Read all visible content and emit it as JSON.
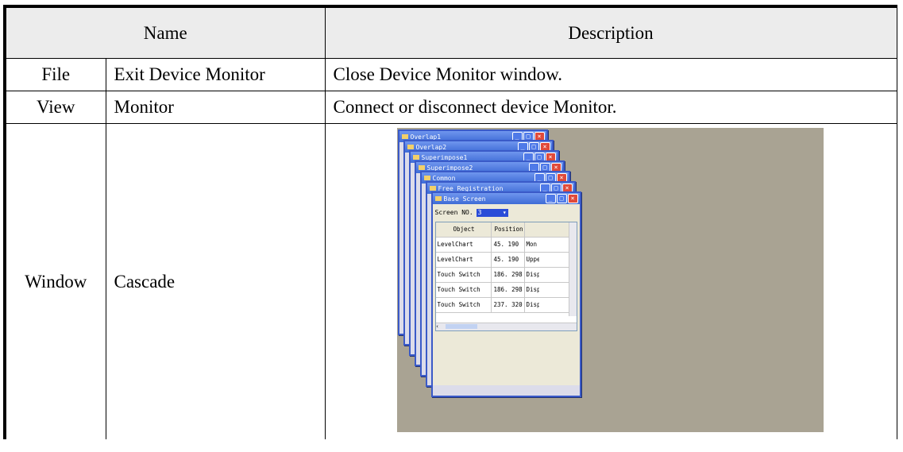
{
  "table": {
    "headers": {
      "name": "Name",
      "description": "Description"
    },
    "rows": [
      {
        "category": "File",
        "command": "Exit Device Monitor",
        "description": "Close Device Monitor window."
      },
      {
        "category": "View",
        "command": "Monitor",
        "description": "Connect or disconnect device Monitor."
      },
      {
        "category": "Window",
        "command": "Cascade",
        "description": ""
      }
    ]
  },
  "screenshot": {
    "background_color": "#a9a393",
    "windows": [
      "Overlap1",
      "Overlap2",
      "Superimpose1",
      "Superimpose2",
      "Common",
      "Free Registration",
      "Base Screen"
    ],
    "screen_no_label": "Screen NO.",
    "screen_no_value": "3",
    "columns": [
      "Object",
      "Position",
      ""
    ],
    "grid_rows": [
      [
        "LevelChart",
        "45. 190",
        "Mon"
      ],
      [
        "LevelChart",
        "45. 190",
        "Uppe"
      ],
      [
        "Touch Switch",
        "186. 298",
        "Disp"
      ],
      [
        "Touch Switch",
        "186. 298",
        "Disp"
      ],
      [
        "Touch Switch",
        "237. 320",
        "Disp"
      ]
    ]
  }
}
